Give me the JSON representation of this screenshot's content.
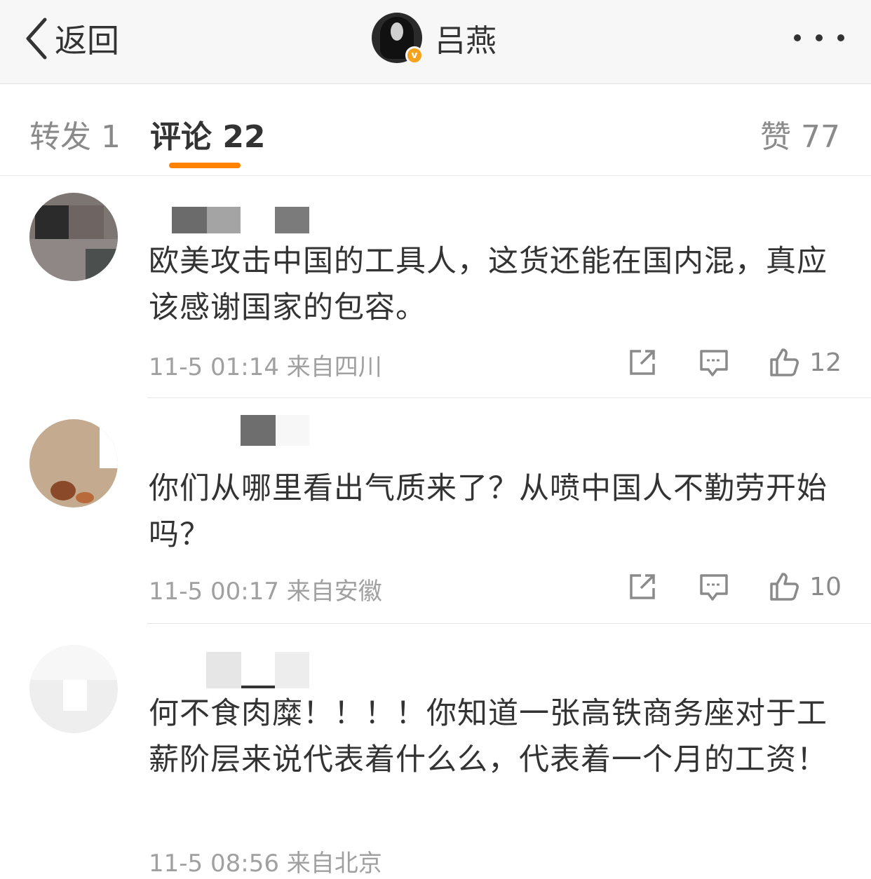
{
  "header": {
    "back_label": "返回",
    "profile_name": "吕燕",
    "verified_badge": "v",
    "icons": {
      "back": "chevron-left-icon",
      "more": "more-dots-icon"
    }
  },
  "tabs": {
    "repost": "转发 1",
    "comment": "评论 22",
    "like": "赞 77",
    "active": "comment",
    "accent_color": "#ff8200"
  },
  "comments": [
    {
      "text": "欧美攻击中国的工具人，这货还能在国内混，真应该感谢国家的包容。",
      "time": "11-5 01:14",
      "location": "来自四川",
      "likes": "12"
    },
    {
      "text": "你们从哪里看出气质来了？从喷中国人不勤劳开始吗？",
      "time": "11-5 00:17",
      "location": "来自安徽",
      "likes": "10"
    },
    {
      "text": "何不食肉糜！！！！你知道一张高铁商务座对于工薪阶层来说代表着什么么，代表着一个月的工资！",
      "time": "11-5 08:56",
      "location": "来自北京"
    }
  ],
  "icons": {
    "share": "share-icon",
    "reply": "comment-icon",
    "like": "thumbs-up-icon"
  }
}
